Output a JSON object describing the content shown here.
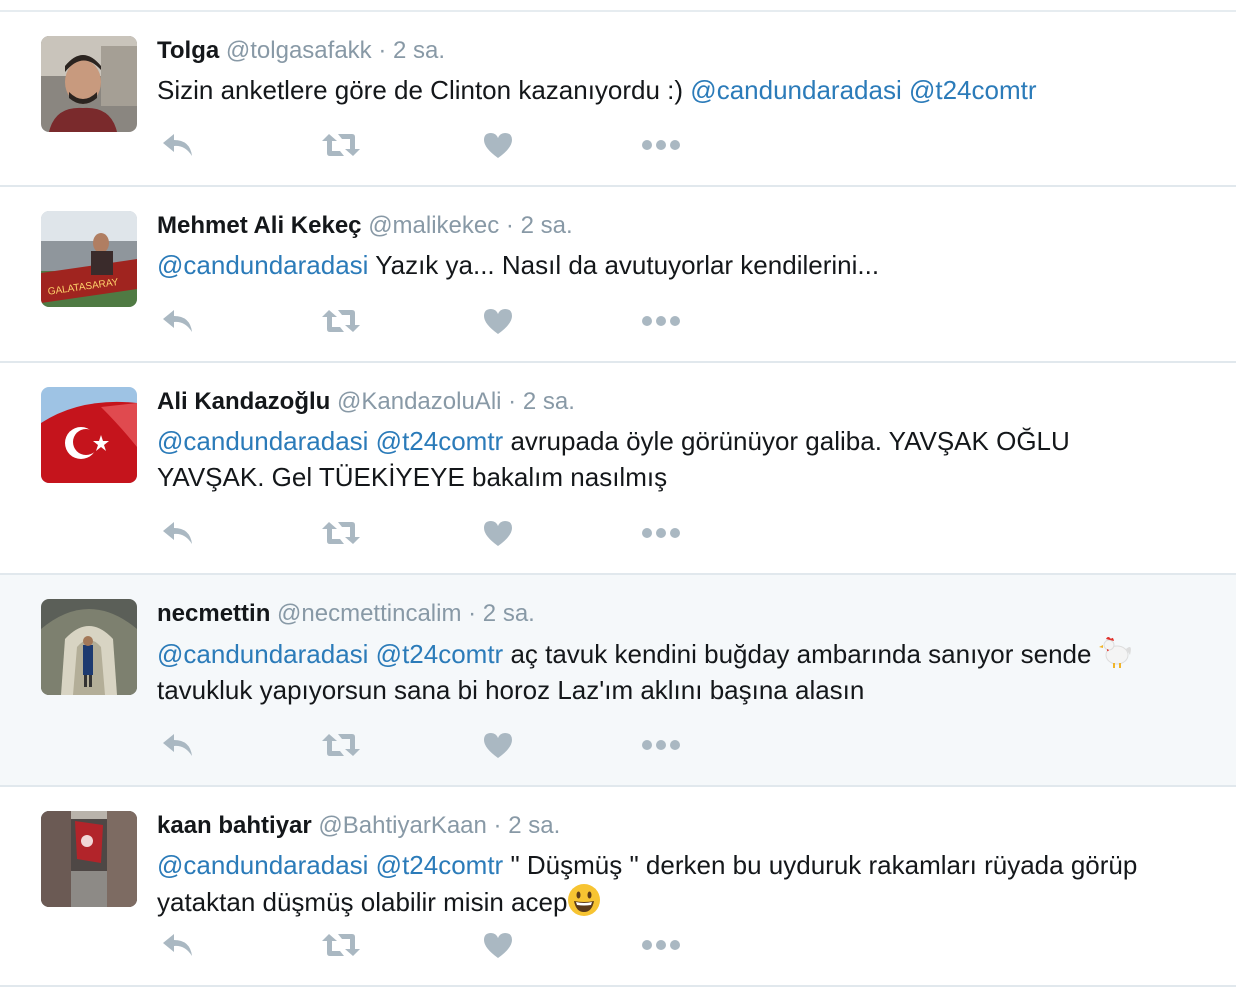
{
  "tweets": [
    {
      "fullname": "Tolga",
      "handle": "@tolgasafakk",
      "separator": "·",
      "time": "2 sa.",
      "avatar_icon": "user-photo-man-in-car",
      "text_parts": [
        {
          "type": "text",
          "value": "Sizin anketlere göre de Clinton kazanıyordu :) "
        },
        {
          "type": "mention",
          "value": "@candundaradasi"
        },
        {
          "type": "text",
          "value": " "
        },
        {
          "type": "mention",
          "value": "@t24comtr"
        }
      ]
    },
    {
      "fullname": "Mehmet Ali Kekeç",
      "handle": "@malikekec",
      "separator": "·",
      "time": "2 sa.",
      "avatar_icon": "user-photo-stadium",
      "text_parts": [
        {
          "type": "mention",
          "value": "@candundaradasi"
        },
        {
          "type": "text",
          "value": " Yazık ya... Nasıl da avutuyorlar kendilerini..."
        }
      ]
    },
    {
      "fullname": "Ali Kandazoğlu",
      "handle": "@KandazoluAli",
      "separator": "·",
      "time": "2 sa.",
      "avatar_icon": "turkish-flag-photo",
      "text_parts": [
        {
          "type": "mention",
          "value": "@candundaradasi"
        },
        {
          "type": "text",
          "value": " "
        },
        {
          "type": "mention",
          "value": "@t24comtr"
        },
        {
          "type": "text",
          "value": " avrupada öyle görünüyor galiba. YAVŞAK OĞLU YAVŞAK. Gel TÜEKİYEYE bakalım nasılmış"
        }
      ]
    },
    {
      "fullname": "necmettin",
      "handle": "@necmettincalim",
      "separator": "·",
      "time": "2 sa.",
      "avatar_icon": "user-photo-tunnel",
      "text_parts": [
        {
          "type": "mention",
          "value": "@candundaradasi"
        },
        {
          "type": "text",
          "value": " "
        },
        {
          "type": "mention",
          "value": "@t24comtr"
        },
        {
          "type": "text",
          "value": " aç tavuk kendini buğday ambarında sanıyor sende "
        },
        {
          "type": "emoji",
          "value": "rooster-emoji"
        },
        {
          "type": "text",
          "value": " tavukluk yapıyorsun sana bi horoz Laz'ım aklını başına alasın"
        }
      ]
    },
    {
      "fullname": "kaan bahtiyar",
      "handle": "@BahtiyarKaan",
      "separator": "·",
      "time": "2 sa.",
      "avatar_icon": "user-photo-street-flag",
      "text_parts": [
        {
          "type": "mention",
          "value": "@candundaradasi"
        },
        {
          "type": "text",
          "value": " "
        },
        {
          "type": "mention",
          "value": "@t24comtr"
        },
        {
          "type": "text",
          "value": " \" Düşmüş \" derken bu uyduruk rakamları rüyada görüp yataktan düşmüş olabilir misin acep"
        },
        {
          "type": "emoji",
          "value": "smiley-emoji"
        }
      ]
    }
  ],
  "action_icons": [
    "reply-icon",
    "retweet-icon",
    "like-icon",
    "more-icon"
  ],
  "colors": {
    "mention": "#2b7bb9",
    "muted": "#8899a6",
    "action": "#aab8c2",
    "hover_bg": "#f5f8fa",
    "divider": "#e1e8ed"
  }
}
